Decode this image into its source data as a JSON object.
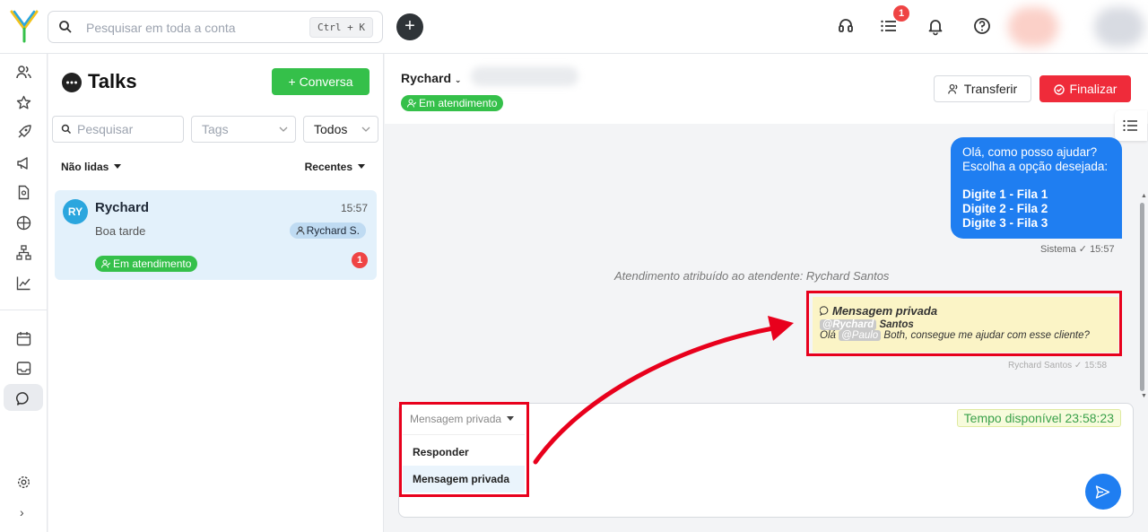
{
  "topbar": {
    "search_placeholder": "Pesquisar em toda a conta",
    "search_shortcut": "Ctrl + K",
    "add_label": "+",
    "notification_count": "1"
  },
  "rail": {
    "icons": [
      "users-icon",
      "star-icon",
      "rocket-icon",
      "megaphone-icon",
      "document-icon",
      "globe-icon",
      "hierarchy-icon",
      "chart-icon",
      "calendar-icon",
      "inbox-icon",
      "chat-icon",
      "settings-icon",
      "expand-icon"
    ],
    "expand_label": "›"
  },
  "list": {
    "title": "Talks",
    "new_button": "+ Conversa",
    "search_placeholder": "Pesquisar",
    "tags_placeholder": "Tags",
    "filter_value": "Todos",
    "unread_filter": "Não lidas",
    "sort_filter": "Recentes",
    "conversation": {
      "initials": "RY",
      "name": "Rychard",
      "time": "15:57",
      "preview": "Boa tarde",
      "agent": "Rychard S.",
      "status": "Em atendimento",
      "unread": "1"
    }
  },
  "chat": {
    "contact_name": "Rychard",
    "status": "Em atendimento",
    "transfer_button": "Transferir",
    "finish_button": "Finalizar",
    "system_message": {
      "lines": [
        "Olá, como posso ajudar?",
        "Escolha a opção desejada:"
      ],
      "options": [
        "Digite 1 - Fila 1",
        "Digite 2 - Fila 2",
        "Digite 3 - Fila 3"
      ],
      "meta": "Sistema ✓ 15:57"
    },
    "assignment_note": "Atendimento atribuído ao atendente: Rychard Santos",
    "private_message": {
      "title": "Mensagem privada",
      "mention_1": "@Rychard",
      "line1_rest": "Santos",
      "line2_pre": "Olá",
      "mention_2": "@Paulo",
      "line2_rest": "Both, consegue me ajudar com esse cliente?",
      "meta": "Rychard Santos ✓ 15:58"
    }
  },
  "composer": {
    "mode": "Mensagem privada",
    "timer": "Tempo disponível 23:58:23",
    "options": [
      "Responder",
      "Mensagem privada"
    ]
  },
  "colors": {
    "green": "#35c04a",
    "blue": "#1f7ef1",
    "red": "#ef2b3a",
    "annotation_red": "#e8001c"
  }
}
